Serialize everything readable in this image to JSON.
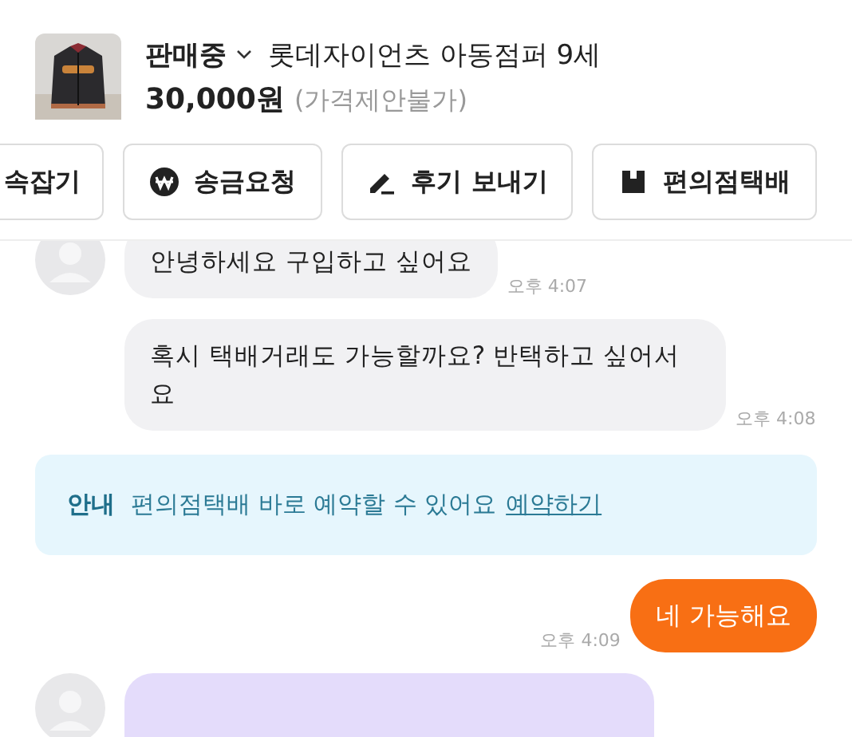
{
  "product": {
    "status": "판매중",
    "title": "롯데자이언츠 아동점퍼 9세",
    "price": "30,000원",
    "price_note": "(가격제안불가)"
  },
  "actions": [
    {
      "label": "속잡기",
      "kind": "plain"
    },
    {
      "label": "송금요청",
      "kind": "money"
    },
    {
      "label": "후기 보내기",
      "kind": "review"
    },
    {
      "label": "편의점택배",
      "kind": "delivery"
    }
  ],
  "messages": [
    {
      "kind": "received",
      "avatar": true,
      "text": "안녕하세요 구입하고 싶어요",
      "time": "오후 4:07"
    },
    {
      "kind": "received",
      "avatar": false,
      "text": "혹시 택배거래도 가능할까요? 반택하고 싶어서요",
      "time": "오후 4:08"
    },
    {
      "kind": "notice",
      "label": "안내",
      "text": "편의점택배 바로 예약할 수 있어요",
      "link": "예약하기"
    },
    {
      "kind": "sent",
      "text": "네 가능해요",
      "time": "오후 4:09"
    },
    {
      "kind": "received",
      "avatar": true,
      "color": "#e4dcfb"
    }
  ]
}
